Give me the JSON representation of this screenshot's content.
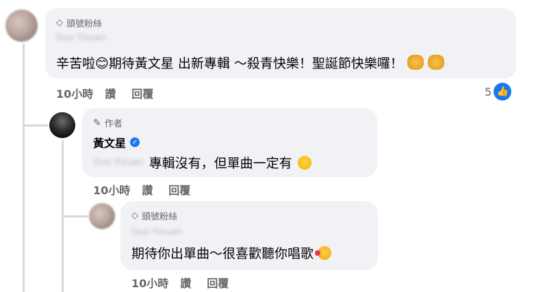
{
  "comment1": {
    "badge": "頭號粉絲",
    "name": "Guo Yixuan",
    "text": "辛苦啦😊期待黃文星 出新專輯 ～殺青快樂！聖誕節快樂囉！",
    "time": "10小時",
    "like_label": "讚",
    "reply_label": "回覆",
    "reaction_count": "5"
  },
  "reply1": {
    "badge": "作者",
    "name": "黃文星",
    "mention": "Guo Yixuan",
    "text": "專輯沒有，但單曲一定有",
    "time": "10小時",
    "like_label": "讚",
    "reply_label": "回覆"
  },
  "reply2": {
    "badge": "頭號粉絲",
    "name": "Guo Yixuan",
    "text": "期待你出單曲～很喜歡聽你唱歌",
    "time": "10小時",
    "like_label": "讚",
    "reply_label": "回覆"
  },
  "colors": {
    "bubble": "#f0f2f5",
    "secondary_text": "#65676b",
    "like_blue": "#1877f2",
    "verified_blue": "#1877f2"
  }
}
